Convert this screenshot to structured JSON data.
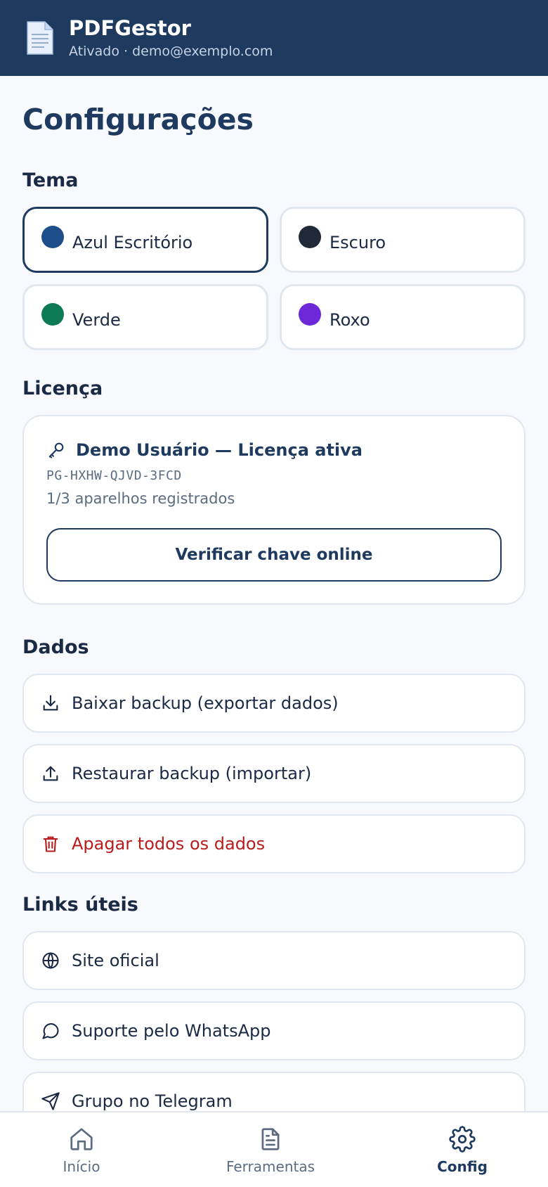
{
  "header": {
    "title": "PDFGestor",
    "status": "Ativado · demo@exemplo.com",
    "icon": "document-icon"
  },
  "page": {
    "title": "Configurações"
  },
  "theme": {
    "section_title": "Tema",
    "selected": "Azul Escritório",
    "options": [
      {
        "label": "Azul Escritório",
        "color": "#1d4e89"
      },
      {
        "label": "Escuro",
        "color": "#1f2937"
      },
      {
        "label": "Verde",
        "color": "#0b7a55"
      },
      {
        "label": "Roxo",
        "color": "#6d28d9"
      }
    ]
  },
  "license": {
    "section_title": "Licença",
    "icon": "key-icon",
    "name_status": "Demo Usuário — Licença ativa",
    "key": "PG-HXHW-QJVD-3FCD",
    "devices": "1/3 aparelhos registrados",
    "verify_label": "Verificar chave online"
  },
  "data_section": {
    "section_title": "Dados",
    "items": [
      {
        "label": "Baixar backup (exportar dados)",
        "icon": "download-icon"
      },
      {
        "label": "Restaurar backup (importar)",
        "icon": "upload-icon"
      },
      {
        "label": "Apagar todos os dados",
        "icon": "trash-icon",
        "danger": true
      }
    ]
  },
  "links": {
    "section_title": "Links úteis",
    "items": [
      {
        "label": "Site oficial",
        "icon": "globe-icon"
      },
      {
        "label": "Suporte pelo WhatsApp",
        "icon": "chat-icon"
      },
      {
        "label": "Grupo no Telegram",
        "icon": "send-icon"
      }
    ]
  },
  "nav": {
    "active": "Config",
    "items": [
      {
        "label": "Início",
        "icon": "home-icon"
      },
      {
        "label": "Ferramentas",
        "icon": "file-text-icon"
      },
      {
        "label": "Config",
        "icon": "gear-icon"
      }
    ]
  },
  "colors": {
    "primary": "#1e3a5f",
    "danger": "#b91c1c",
    "border": "#e1e7ef",
    "background": "#f7f9fc"
  }
}
